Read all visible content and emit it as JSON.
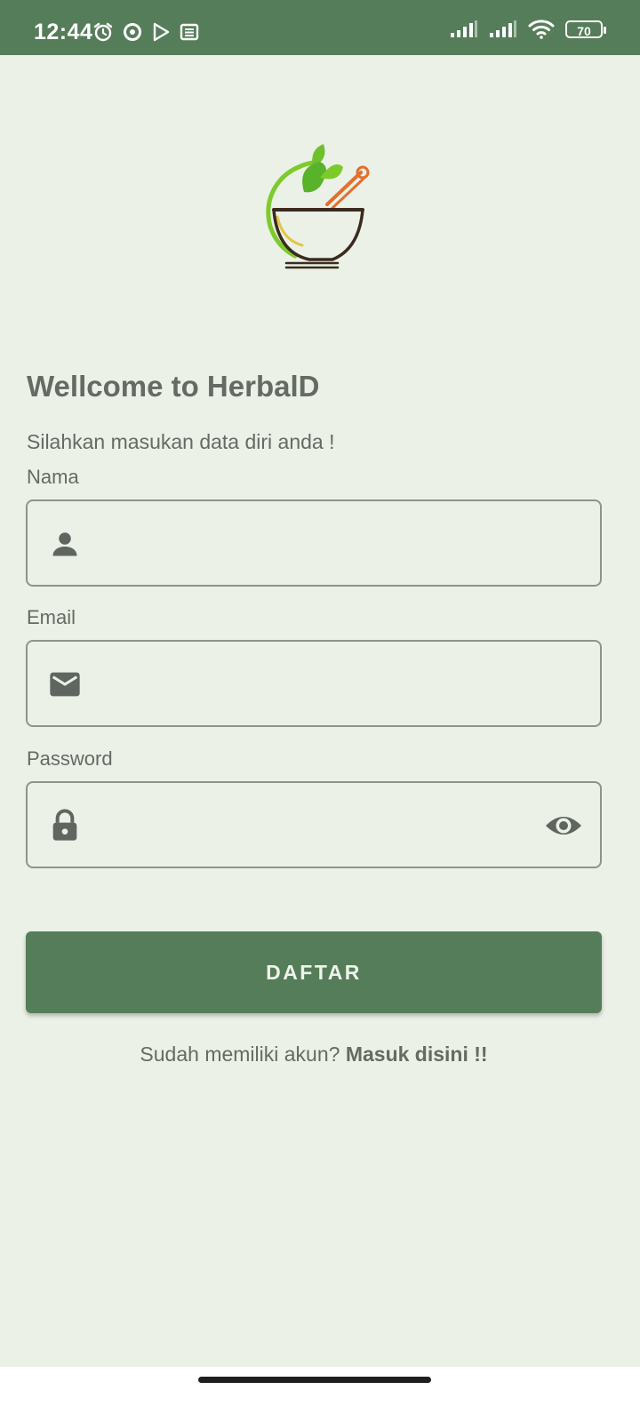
{
  "status_bar": {
    "time": "12:44",
    "left_icons": [
      "alarm-icon",
      "record-icon",
      "play-store-icon",
      "news-icon"
    ],
    "right_icons": [
      "signal-icon",
      "signal-icon",
      "wifi-icon",
      "battery-icon"
    ],
    "battery_level": "70"
  },
  "header": {
    "logo": "mortar-pestle-leaf-logo",
    "title": "Wellcome to HerbalD",
    "subtitle": "Silahkan masukan data diri anda !"
  },
  "form": {
    "name_label": "Nama",
    "name_value": "",
    "email_label": "Email",
    "email_value": "",
    "password_label": "Password",
    "password_value": "",
    "submit_label": "DAFTAR"
  },
  "footer": {
    "prompt": "Sudah memiliki akun? ",
    "link": "Masuk disini !!"
  },
  "colors": {
    "primary": "#567D59",
    "background": "#EBF1E7",
    "text": "#646B64"
  }
}
